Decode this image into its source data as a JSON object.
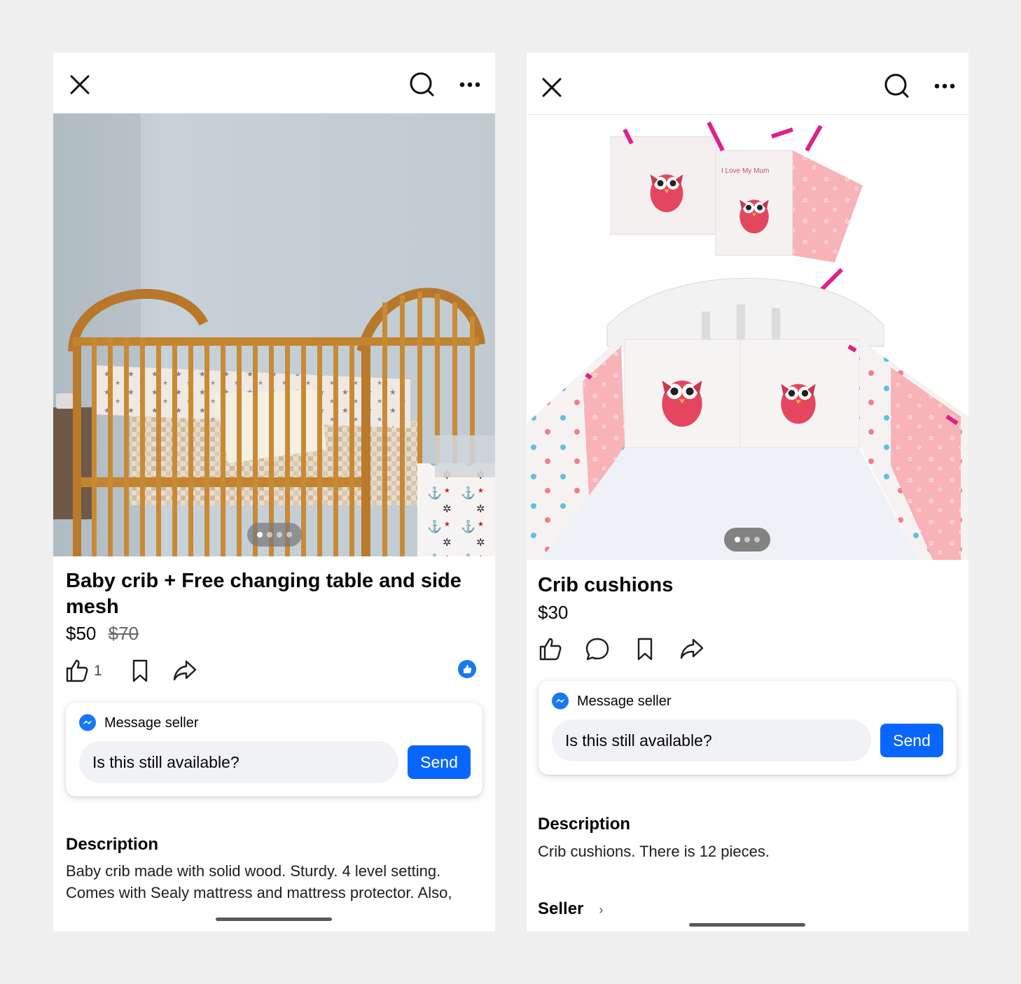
{
  "listings": [
    {
      "title": "Baby crib + Free changing table and side mesh",
      "price": "$50",
      "original_price": "$70",
      "like_count": "1",
      "photo_pages": 4,
      "photo_active_index": 0,
      "message": {
        "header": "Message seller",
        "input_value": "Is this still available?",
        "send_label": "Send"
      },
      "description_heading": "Description",
      "description_text": "Baby crib made with solid wood. Sturdy. 4 level setting. Comes with Sealy mattress and mattress protector. Also,"
    },
    {
      "title": "Crib cushions",
      "price": "$30",
      "photo_pages": 3,
      "photo_active_index": 0,
      "photo_print_text": "I Love My Mum",
      "message": {
        "header": "Message seller",
        "input_value": "Is this still available?",
        "send_label": "Send"
      },
      "description_heading": "Description",
      "description_text": "Crib cushions. There is 12 pieces.",
      "seller_label": "Seller",
      "seller_chevron": "›"
    }
  ],
  "icons": {
    "close": "close-icon",
    "search": "search-icon",
    "more": "more-icon",
    "like": "thumbs-up-icon",
    "save": "bookmark-icon",
    "share": "share-icon",
    "comment": "comment-icon",
    "messenger": "messenger-icon",
    "like_badge": "like-badge-icon"
  },
  "colors": {
    "accent": "#0866ff",
    "background": "#efefef",
    "input_bg": "#f0f2f5"
  }
}
